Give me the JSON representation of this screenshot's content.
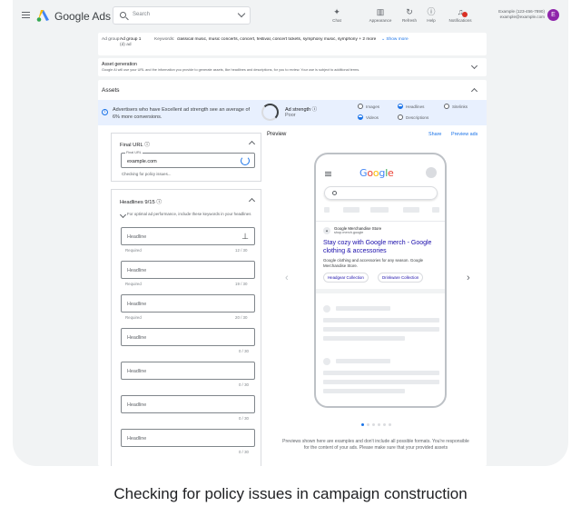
{
  "header": {
    "brand": "Google Ads",
    "search_placeholder": "Search",
    "tools": [
      {
        "label": "Chat",
        "icon": "sparkle-icon"
      },
      {
        "label": "Appearance",
        "icon": "appearance-icon"
      },
      {
        "label": "Refresh",
        "icon": "refresh-icon"
      },
      {
        "label": "Help",
        "icon": "help-icon"
      },
      {
        "label": "Notifications",
        "icon": "bell-icon"
      }
    ],
    "account_line1": "Example (123-456-7890)",
    "account_line2": "example@example.com",
    "avatar_letter": "E"
  },
  "ad_group": {
    "label": "Ad group:",
    "value_line1": "Ad group 1",
    "value_line2": "(d) ad",
    "keywords_label": "Keywords:",
    "keywords_value": "classical music, music concerts, concert, festival, concert tickets, symphony music, symphony + 2 more",
    "show_more": "Show more"
  },
  "asset_generation": {
    "title": "Asset generation",
    "description": "Google AI will use your URL and the information you provide to generate assets, like headlines and descriptions, for you to review. Your use is subject to additional terms."
  },
  "assets": {
    "title": "Assets",
    "strength_message": "Advertisers who have Excellent ad strength see an average of 6% more conversions.",
    "strength_label": "Ad strength",
    "strength_value": "Poor",
    "checks": [
      {
        "label": "Images",
        "state": "empty"
      },
      {
        "label": "Headlines",
        "state": "half"
      },
      {
        "label": "Sitelinks",
        "state": "empty"
      },
      {
        "label": "Videos",
        "state": "half"
      },
      {
        "label": "Descriptions",
        "state": "empty"
      }
    ]
  },
  "final_url": {
    "title": "Final URL",
    "field_label": "Final URL",
    "value": "example.com",
    "status": "Checking for policy issues..."
  },
  "headlines": {
    "title": "Headlines 9/15",
    "note": "For optimal ad performance, include these keywords in your headlines",
    "placeholder": "Headline",
    "items": [
      {
        "sub": "Required",
        "count": "12 / 30",
        "pinned": true
      },
      {
        "sub": "Required",
        "count": "19 / 30",
        "pinned": false
      },
      {
        "sub": "Required",
        "count": "20 / 30",
        "pinned": false
      },
      {
        "sub": "",
        "count": "0 / 30",
        "pinned": false
      },
      {
        "sub": "",
        "count": "0 / 30",
        "pinned": false
      },
      {
        "sub": "",
        "count": "0 / 30",
        "pinned": false
      },
      {
        "sub": "",
        "count": "0 / 30",
        "pinned": false
      }
    ]
  },
  "preview": {
    "title": "Preview",
    "share": "Share",
    "preview_ads": "Preview ads",
    "logo": "Google",
    "store_name": "Google Merchandise Store",
    "store_url": "shop.merch.google",
    "ad_headline": "Stay cozy with Google merch - Google clothing & accessories",
    "ad_description": "Google clothing and accessories for any season. Google Merchandise Store.",
    "sitelinks": [
      "Headgear Collection",
      "Drinkware Collection"
    ],
    "disclaimer": "Previews shown here are examples and don't include all possible formats. You're responsible for the content of your ads. Please make sure that your provided assets"
  },
  "caption": "Checking for policy issues in campaign construction",
  "colors": {
    "accent": "#1a73e8",
    "avatar": "#8e24aa",
    "link": "#1a0dab",
    "notification": "#d93025"
  }
}
